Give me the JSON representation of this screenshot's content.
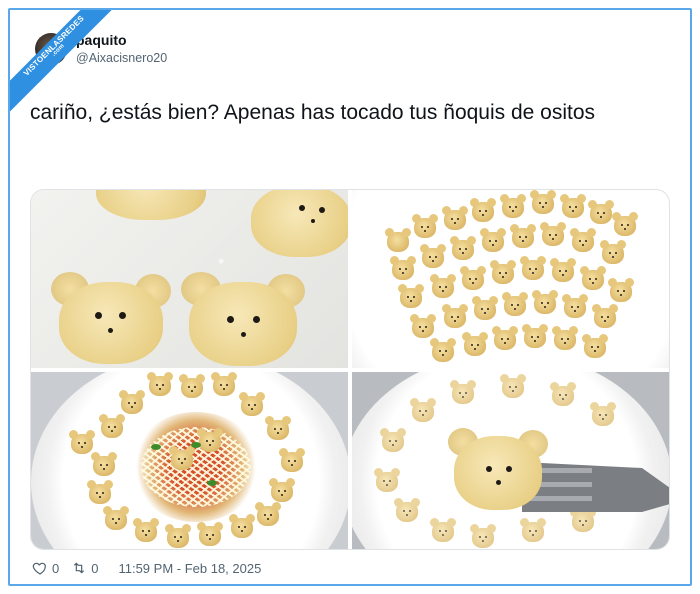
{
  "watermark": {
    "text": "VISTOENLASREDES",
    "domain": ".com"
  },
  "author": {
    "name": "paquito",
    "handle": "@Aixacisnero20"
  },
  "tweet": {
    "text": "cariño, ¿estás bien? Apenas has tocado tus ñoquis de ositos"
  },
  "stats": {
    "likes": "0",
    "retweets": "0",
    "timestamp": "11:59 PM - Feb 18, 2025"
  },
  "icons": {
    "like": "heart-icon",
    "retweet": "retweet-icon"
  },
  "colors": {
    "frame": "#5aa7ea",
    "ribbon": "#2f8fe0",
    "text": "#0f1419",
    "muted": "#536471"
  },
  "media": {
    "images": [
      {
        "id": "bear-gnocchi-raw-closeup"
      },
      {
        "id": "bear-gnocchi-plate-raw"
      },
      {
        "id": "bear-gnocchi-plate-sauce"
      },
      {
        "id": "bear-gnocchi-on-fork"
      }
    ]
  }
}
